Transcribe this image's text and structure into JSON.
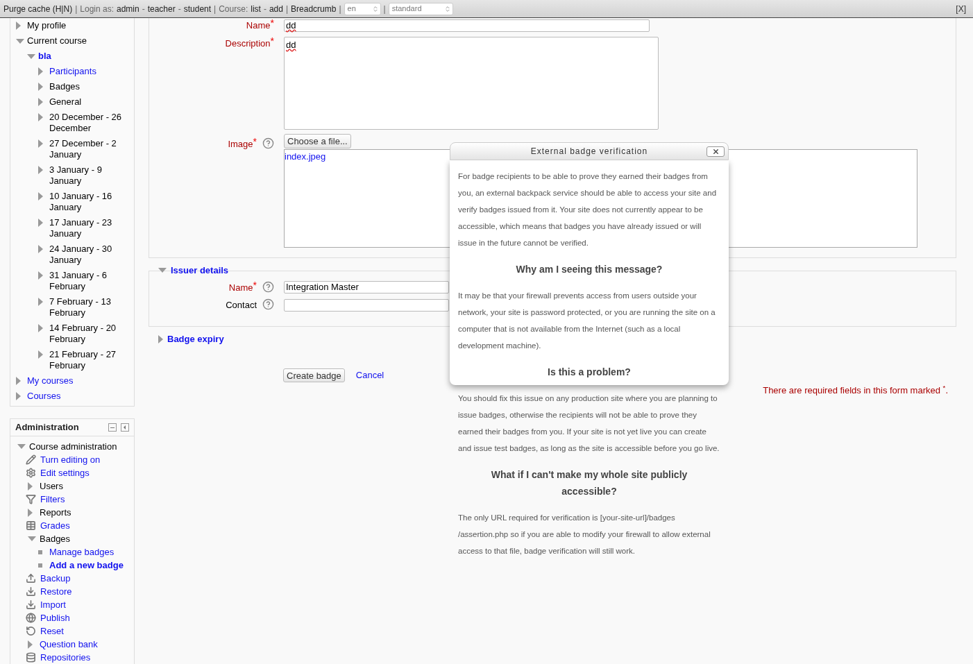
{
  "top_bar": {
    "segments": [
      {
        "kind": "link",
        "text": "Purge cache (H|N)"
      },
      {
        "kind": "separator",
        "text": "|"
      },
      {
        "kind": "text",
        "text": "Login as:"
      },
      {
        "kind": "link",
        "text": "admin"
      },
      {
        "kind": "text",
        "text": "-"
      },
      {
        "kind": "link",
        "text": "teacher"
      },
      {
        "kind": "text",
        "text": "-"
      },
      {
        "kind": "link",
        "text": "student"
      },
      {
        "kind": "separator",
        "text": "|"
      },
      {
        "kind": "text",
        "text": "Course:"
      },
      {
        "kind": "link",
        "text": "list"
      },
      {
        "kind": "text",
        "text": "-"
      },
      {
        "kind": "link",
        "text": "add"
      },
      {
        "kind": "separator",
        "text": "|"
      },
      {
        "kind": "link",
        "text": "Breadcrumb"
      },
      {
        "kind": "separator",
        "text": "|"
      },
      {
        "kind": "select",
        "text": "en"
      },
      {
        "kind": "separator",
        "text": "|"
      },
      {
        "kind": "select",
        "text": "standard"
      }
    ],
    "close": "[X]"
  },
  "navigation": {
    "items": [
      {
        "label": "My profile",
        "link": false,
        "active": false,
        "expanded": false
      },
      {
        "label": "Current course",
        "link": false,
        "active": false,
        "expanded": true,
        "children": [
          {
            "label": "bla",
            "link": true,
            "active": true,
            "expanded": true,
            "children": [
              {
                "label": "Participants",
                "link": true,
                "active": false,
                "expanded": false
              },
              {
                "label": "Badges",
                "link": false,
                "active": false,
                "expanded": false
              },
              {
                "label": "General",
                "link": false,
                "active": false,
                "expanded": false
              },
              {
                "label": "20 December - 26 December",
                "link": false,
                "active": false,
                "expanded": false
              },
              {
                "label": "27 December - 2 January",
                "link": false,
                "active": false,
                "expanded": false
              },
              {
                "label": "3 January - 9 January",
                "link": false,
                "active": false,
                "expanded": false
              },
              {
                "label": "10 January - 16 January",
                "link": false,
                "active": false,
                "expanded": false
              },
              {
                "label": "17 January - 23 January",
                "link": false,
                "active": false,
                "expanded": false
              },
              {
                "label": "24 January - 30 January",
                "link": false,
                "active": false,
                "expanded": false
              },
              {
                "label": "31 January - 6 February",
                "link": false,
                "active": false,
                "expanded": false
              },
              {
                "label": "7 February - 13 February",
                "link": false,
                "active": false,
                "expanded": false
              },
              {
                "label": "14 February - 20 February",
                "link": false,
                "active": false,
                "expanded": false
              },
              {
                "label": "21 February - 27 February",
                "link": false,
                "active": false,
                "expanded": false
              }
            ]
          }
        ]
      },
      {
        "label": "My courses",
        "link": true,
        "active": false,
        "expanded": false
      },
      {
        "label": "Courses",
        "link": true,
        "active": false,
        "expanded": false
      }
    ]
  },
  "administration": {
    "title": "Administration",
    "items": [
      {
        "label": "Course administration",
        "kind": "node",
        "link": false,
        "active": false,
        "expanded": true,
        "children": [
          {
            "label": "Turn editing on",
            "kind": "action",
            "link": true,
            "active": false
          },
          {
            "label": "Edit settings",
            "kind": "action",
            "link": true,
            "active": false
          },
          {
            "label": "Users",
            "kind": "node",
            "link": false,
            "active": false,
            "expanded": false
          },
          {
            "label": "Filters",
            "kind": "action",
            "link": true,
            "active": false
          },
          {
            "label": "Reports",
            "kind": "node",
            "link": false,
            "active": false,
            "expanded": false
          },
          {
            "label": "Grades",
            "kind": "action",
            "link": true,
            "active": false
          },
          {
            "label": "Badges",
            "kind": "node",
            "link": false,
            "active": false,
            "expanded": true,
            "children": [
              {
                "label": "Manage badges",
                "kind": "leaf",
                "link": true,
                "active": false
              },
              {
                "label": "Add a new badge",
                "kind": "leaf",
                "link": true,
                "active": true
              }
            ]
          },
          {
            "label": "Backup",
            "kind": "action",
            "link": true,
            "active": false
          },
          {
            "label": "Restore",
            "kind": "action",
            "link": true,
            "active": false
          },
          {
            "label": "Import",
            "kind": "action",
            "link": true,
            "active": false
          },
          {
            "label": "Publish",
            "kind": "action",
            "link": true,
            "active": false
          },
          {
            "label": "Reset",
            "kind": "action",
            "link": true,
            "active": false
          },
          {
            "label": "Question bank",
            "kind": "node",
            "link": true,
            "active": false,
            "expanded": false
          },
          {
            "label": "Repositories",
            "kind": "action",
            "link": true,
            "active": false
          }
        ]
      }
    ]
  },
  "form": {
    "required_mark": "*",
    "fieldsets": [
      {
        "expanded": true,
        "fields": [
          {
            "label": "Name",
            "kind": "text",
            "required": true,
            "help": false,
            "value": "dd"
          },
          {
            "label": "Description",
            "kind": "textarea",
            "required": true,
            "help": false,
            "value": "dd"
          },
          {
            "label": "Image",
            "kind": "file",
            "required": true,
            "help": true,
            "button": "Choose a file...",
            "file": "index.jpeg"
          }
        ]
      },
      {
        "legend": "Issuer details",
        "expanded": true,
        "fields": [
          {
            "label": "Name",
            "kind": "text",
            "required": true,
            "help": true,
            "value": "Integration Master"
          },
          {
            "label": "Contact",
            "kind": "text",
            "required": false,
            "help": true
          }
        ]
      },
      {
        "legend": "Badge expiry",
        "expanded": false
      }
    ],
    "buttons": [
      "Create badge"
    ],
    "cancel": "Cancel",
    "required_note": "There are required fields in this form marked $^{*}$."
  },
  "dialog": {
    "title": "External badge verification",
    "blocks": [
      {
        "kind": "paragraph",
        "text": "For badge recipients to be able to prove they earned their badges from you, an external backpack service should be able to access your site and verify badges issued from it. Your site does not currently appear to be accessible, which means that badges you have already issued or will issue in the future cannot be verified."
      },
      {
        "kind": "heading",
        "text": "Why am I seeing this message?"
      },
      {
        "kind": "paragraph",
        "text": "It may be that your firewall prevents access from users outside your network, your site is password protected, or you are running the site on a computer that is not available from the Internet (such as a local development machine)."
      },
      {
        "kind": "heading",
        "text": "Is this a problem?"
      },
      {
        "kind": "paragraph",
        "text": "You should fix this issue on any production site where you are planning to issue badges, otherwise the recipients will not be able to prove they earned their badges from you. If your site is not yet live you can create and issue test badges, as long as the site is accessible before you go live."
      },
      {
        "kind": "heading",
        "text": "What if I can't make my whole site publicly accessible?"
      },
      {
        "kind": "paragraph",
        "text": "The only URL required for verification is [your-site-url]/badges /assertion.php so if you are able to modify your firewall to allow external access to that file, badge verification will still work."
      }
    ]
  }
}
